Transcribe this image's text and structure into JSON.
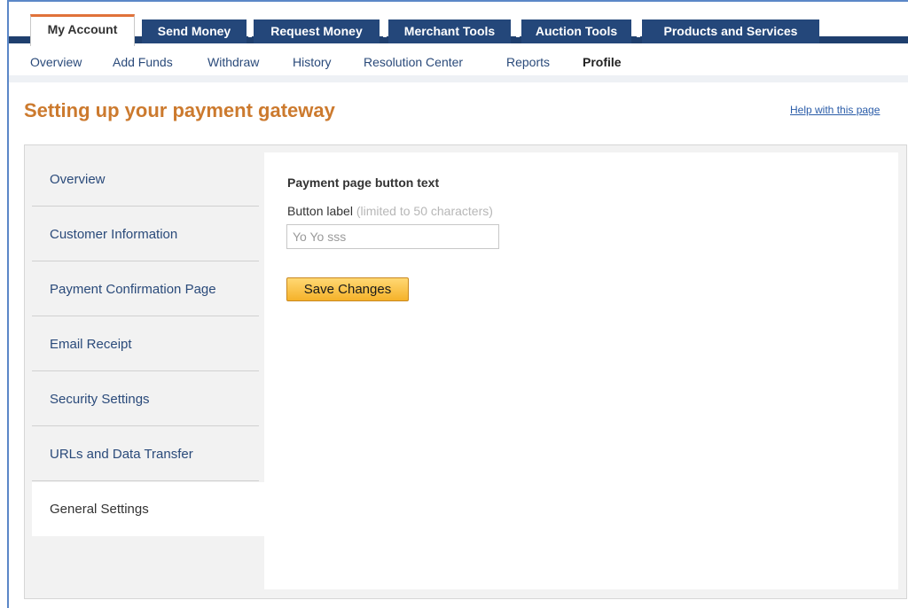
{
  "tabs": [
    {
      "label": "My Account",
      "active": true
    },
    {
      "label": "Send Money",
      "active": false
    },
    {
      "label": "Request Money",
      "active": false
    },
    {
      "label": "Merchant Tools",
      "active": false
    },
    {
      "label": "Auction Tools",
      "active": false
    },
    {
      "label": "Products and Services",
      "active": false
    }
  ],
  "subnav": [
    {
      "label": "Overview",
      "active": false
    },
    {
      "label": "Add Funds",
      "active": false
    },
    {
      "label": "Withdraw",
      "active": false
    },
    {
      "label": "History",
      "active": false
    },
    {
      "label": "Resolution Center",
      "active": false
    },
    {
      "label": "Reports",
      "active": false
    },
    {
      "label": "Profile",
      "active": true
    }
  ],
  "page": {
    "title": "Setting up your payment gateway",
    "help_link": "Help with this page"
  },
  "sidebar": {
    "items": [
      {
        "label": "Overview",
        "active": false
      },
      {
        "label": "Customer Information",
        "active": false
      },
      {
        "label": "Payment Confirmation Page",
        "active": false
      },
      {
        "label": "Email Receipt",
        "active": false
      },
      {
        "label": "Security Settings",
        "active": false
      },
      {
        "label": "URLs and Data Transfer",
        "active": false
      },
      {
        "label": "General Settings",
        "active": true
      }
    ]
  },
  "form": {
    "section_title": "Payment page button text",
    "field_label": "Button label",
    "field_hint": "(limited to 50 characters)",
    "button_label_value": "Yo Yo sss",
    "save_label": "Save Changes"
  },
  "colors": {
    "tab_bg": "#24477a",
    "tab_active_border": "#e0723a",
    "title": "#cc7a2e",
    "link": "#2a5ca8",
    "button": "#f5b22a"
  }
}
